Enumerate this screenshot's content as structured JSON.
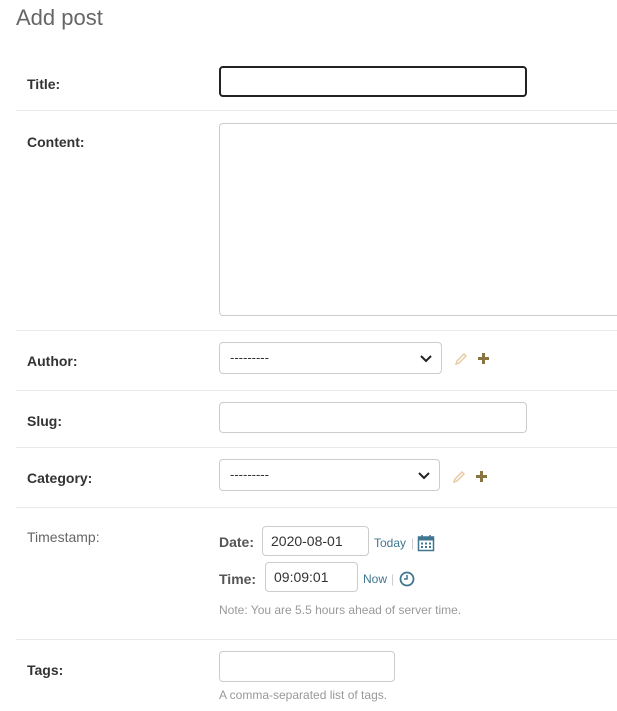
{
  "page": {
    "title": "Add post"
  },
  "fields": {
    "title": {
      "label": "Title:",
      "value": ""
    },
    "content": {
      "label": "Content:",
      "value": ""
    },
    "author": {
      "label": "Author:",
      "selected": "---------"
    },
    "slug": {
      "label": "Slug:",
      "value": ""
    },
    "category": {
      "label": "Category:",
      "selected": "---------"
    },
    "timestamp": {
      "label": "Timestamp:",
      "date_label": "Date:",
      "date_value": "2020-08-01",
      "today_link": "Today",
      "separator": "|",
      "time_label": "Time:",
      "time_value": "09:09:01",
      "now_link": "Now",
      "note": "Note: You are 5.5 hours ahead of server time."
    },
    "tags": {
      "label": "Tags:",
      "value": "",
      "help": "A comma-separated list of tags."
    }
  },
  "icons": {
    "edit": "pencil-icon",
    "add": "plus-icon",
    "calendar": "calendar-icon",
    "clock": "clock-icon"
  },
  "colors": {
    "link": "#417690",
    "add_icon": "#8a7540",
    "edit_icon": "#e6c9a0"
  }
}
